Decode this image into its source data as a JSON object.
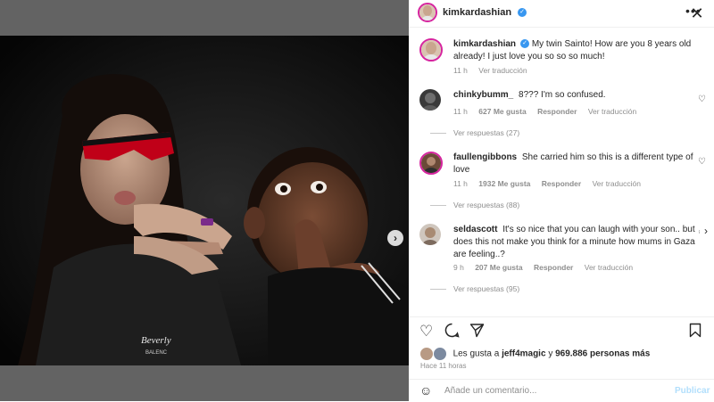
{
  "header": {
    "username": "kimkardashian",
    "more_icon": "more-horizontal-icon"
  },
  "caption": {
    "username": "kimkardashian",
    "text": "My twin Sainto! How are you 8 years old already! I just love you so so so much!",
    "time": "11 h",
    "translate": "Ver traducción"
  },
  "comments": [
    {
      "username": "chinkybumm_",
      "text": "8??? I'm so confused.",
      "time": "11 h",
      "likes": "627 Me gusta",
      "reply": "Responder",
      "translate": "Ver traducción",
      "replies": "Ver respuestas (27)"
    },
    {
      "username": "faullengibbons",
      "text": "She carried him so this is a different type of love",
      "time": "11 h",
      "likes": "1932 Me gusta",
      "reply": "Responder",
      "translate": "Ver traducción",
      "replies": "Ver respuestas (88)"
    },
    {
      "username": "seldascott",
      "text": "It's so nice that you can laugh with your son.. but does this not make you think for a minute how mums in Gaza are feeling..?",
      "time": "9 h",
      "likes": "207 Me gusta",
      "reply": "Responder",
      "translate": "Ver traducción",
      "replies": "Ver respuestas (95)"
    }
  ],
  "likes_line": {
    "prefix": "Les gusta a",
    "user": "jeff4magic",
    "middle": "y",
    "count": "969.886 personas más"
  },
  "time_ago": "Hace 11 horas",
  "add_comment": {
    "placeholder": "Añade un comentario...",
    "post": "Publicar"
  },
  "carousel": {
    "total": 10,
    "active": 0
  },
  "shirt_text": "Beverly",
  "shirt_text2": "BALENC"
}
